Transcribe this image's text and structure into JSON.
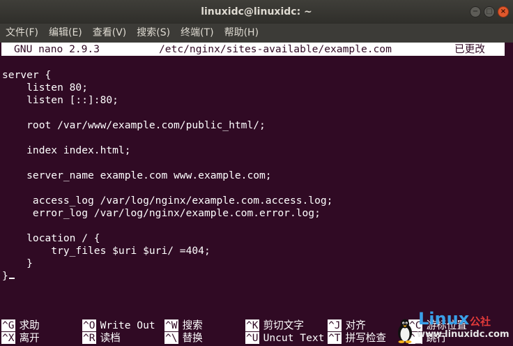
{
  "window": {
    "title": "linuxidc@linuxidc: ~",
    "minimize_glyph": "−",
    "maximize_glyph": "□",
    "close_glyph": "×"
  },
  "menubar": {
    "items": [
      "文件(F)",
      "编辑(E)",
      "查看(V)",
      "搜索(S)",
      "终端(T)",
      "帮助(H)"
    ]
  },
  "nano": {
    "version": "GNU nano 2.9.3",
    "file_path": "/etc/nginx/sites-available/example.com",
    "status": "已更改",
    "content": "server {\n    listen 80;\n    listen [::]:80;\n\n    root /var/www/example.com/public_html/;\n\n    index index.html;\n\n    server_name example.com www.example.com;\n\n     access_log /var/log/nginx/example.com.access.log;\n     error_log /var/log/nginx/example.com.error.log;\n\n    location / {\n        try_files $uri $uri/ =404;\n    }\n}",
    "shortcuts_row1": [
      {
        "key": "^G",
        "label": "求助"
      },
      {
        "key": "^O",
        "label": "Write Out"
      },
      {
        "key": "^W",
        "label": "搜索"
      },
      {
        "key": "^K",
        "label": "剪切文字"
      },
      {
        "key": "^J",
        "label": "对齐"
      },
      {
        "key": "^C",
        "label": "游标位置"
      }
    ],
    "shortcuts_row2": [
      {
        "key": "^X",
        "label": "离开"
      },
      {
        "key": "^R",
        "label": "读档"
      },
      {
        "key": "^\\",
        "label": "替换"
      },
      {
        "key": "^U",
        "label": "Uncut Text"
      },
      {
        "key": "^T",
        "label": "拼写检查"
      },
      {
        "key": "^_",
        "label": "跳行"
      }
    ]
  },
  "watermark": {
    "brand": "Linux",
    "suffix": "公社",
    "url": "www.linuxidc.com"
  }
}
